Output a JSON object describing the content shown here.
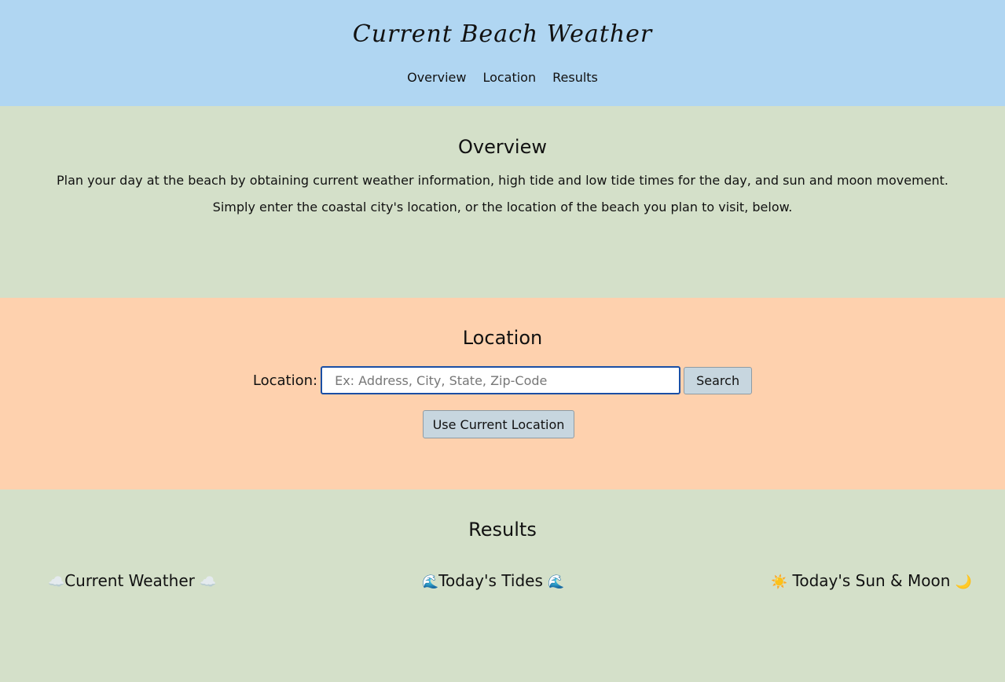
{
  "header": {
    "title": "Current Beach Weather",
    "nav": [
      "Overview",
      "Location",
      "Results"
    ]
  },
  "overview": {
    "heading": "Overview",
    "paragraph1": "Plan your day at the beach by obtaining current weather information, high tide and low tide times for the day, and sun and moon movement.",
    "paragraph2": "Simply enter the coastal city's location, or the location of the beach you plan to visit, below."
  },
  "location": {
    "heading": "Location",
    "label": "Location:",
    "input_value": "",
    "placeholder": "Ex: Address, City, State, Zip-Code",
    "search_label": "Search",
    "current_location_label": "Use Current Location"
  },
  "results": {
    "heading": "Results",
    "weather": {
      "label": "Current Weather",
      "icon_left": "☁️",
      "icon_right": "☁️"
    },
    "tides": {
      "label": "Today's Tides",
      "icon_left": "🌊",
      "icon_right": "🌊"
    },
    "sun_moon": {
      "label": "Today's Sun & Moon",
      "icon_left": "☀️",
      "icon_right": "🌙"
    }
  },
  "colors": {
    "header_bg": "#b0d6f2",
    "overview_bg": "#d4e0c9",
    "location_bg": "#fed1ae",
    "results_bg": "#d4e0c9",
    "button_bg": "#c7d6df",
    "input_focus_border": "#1a4fa5"
  }
}
